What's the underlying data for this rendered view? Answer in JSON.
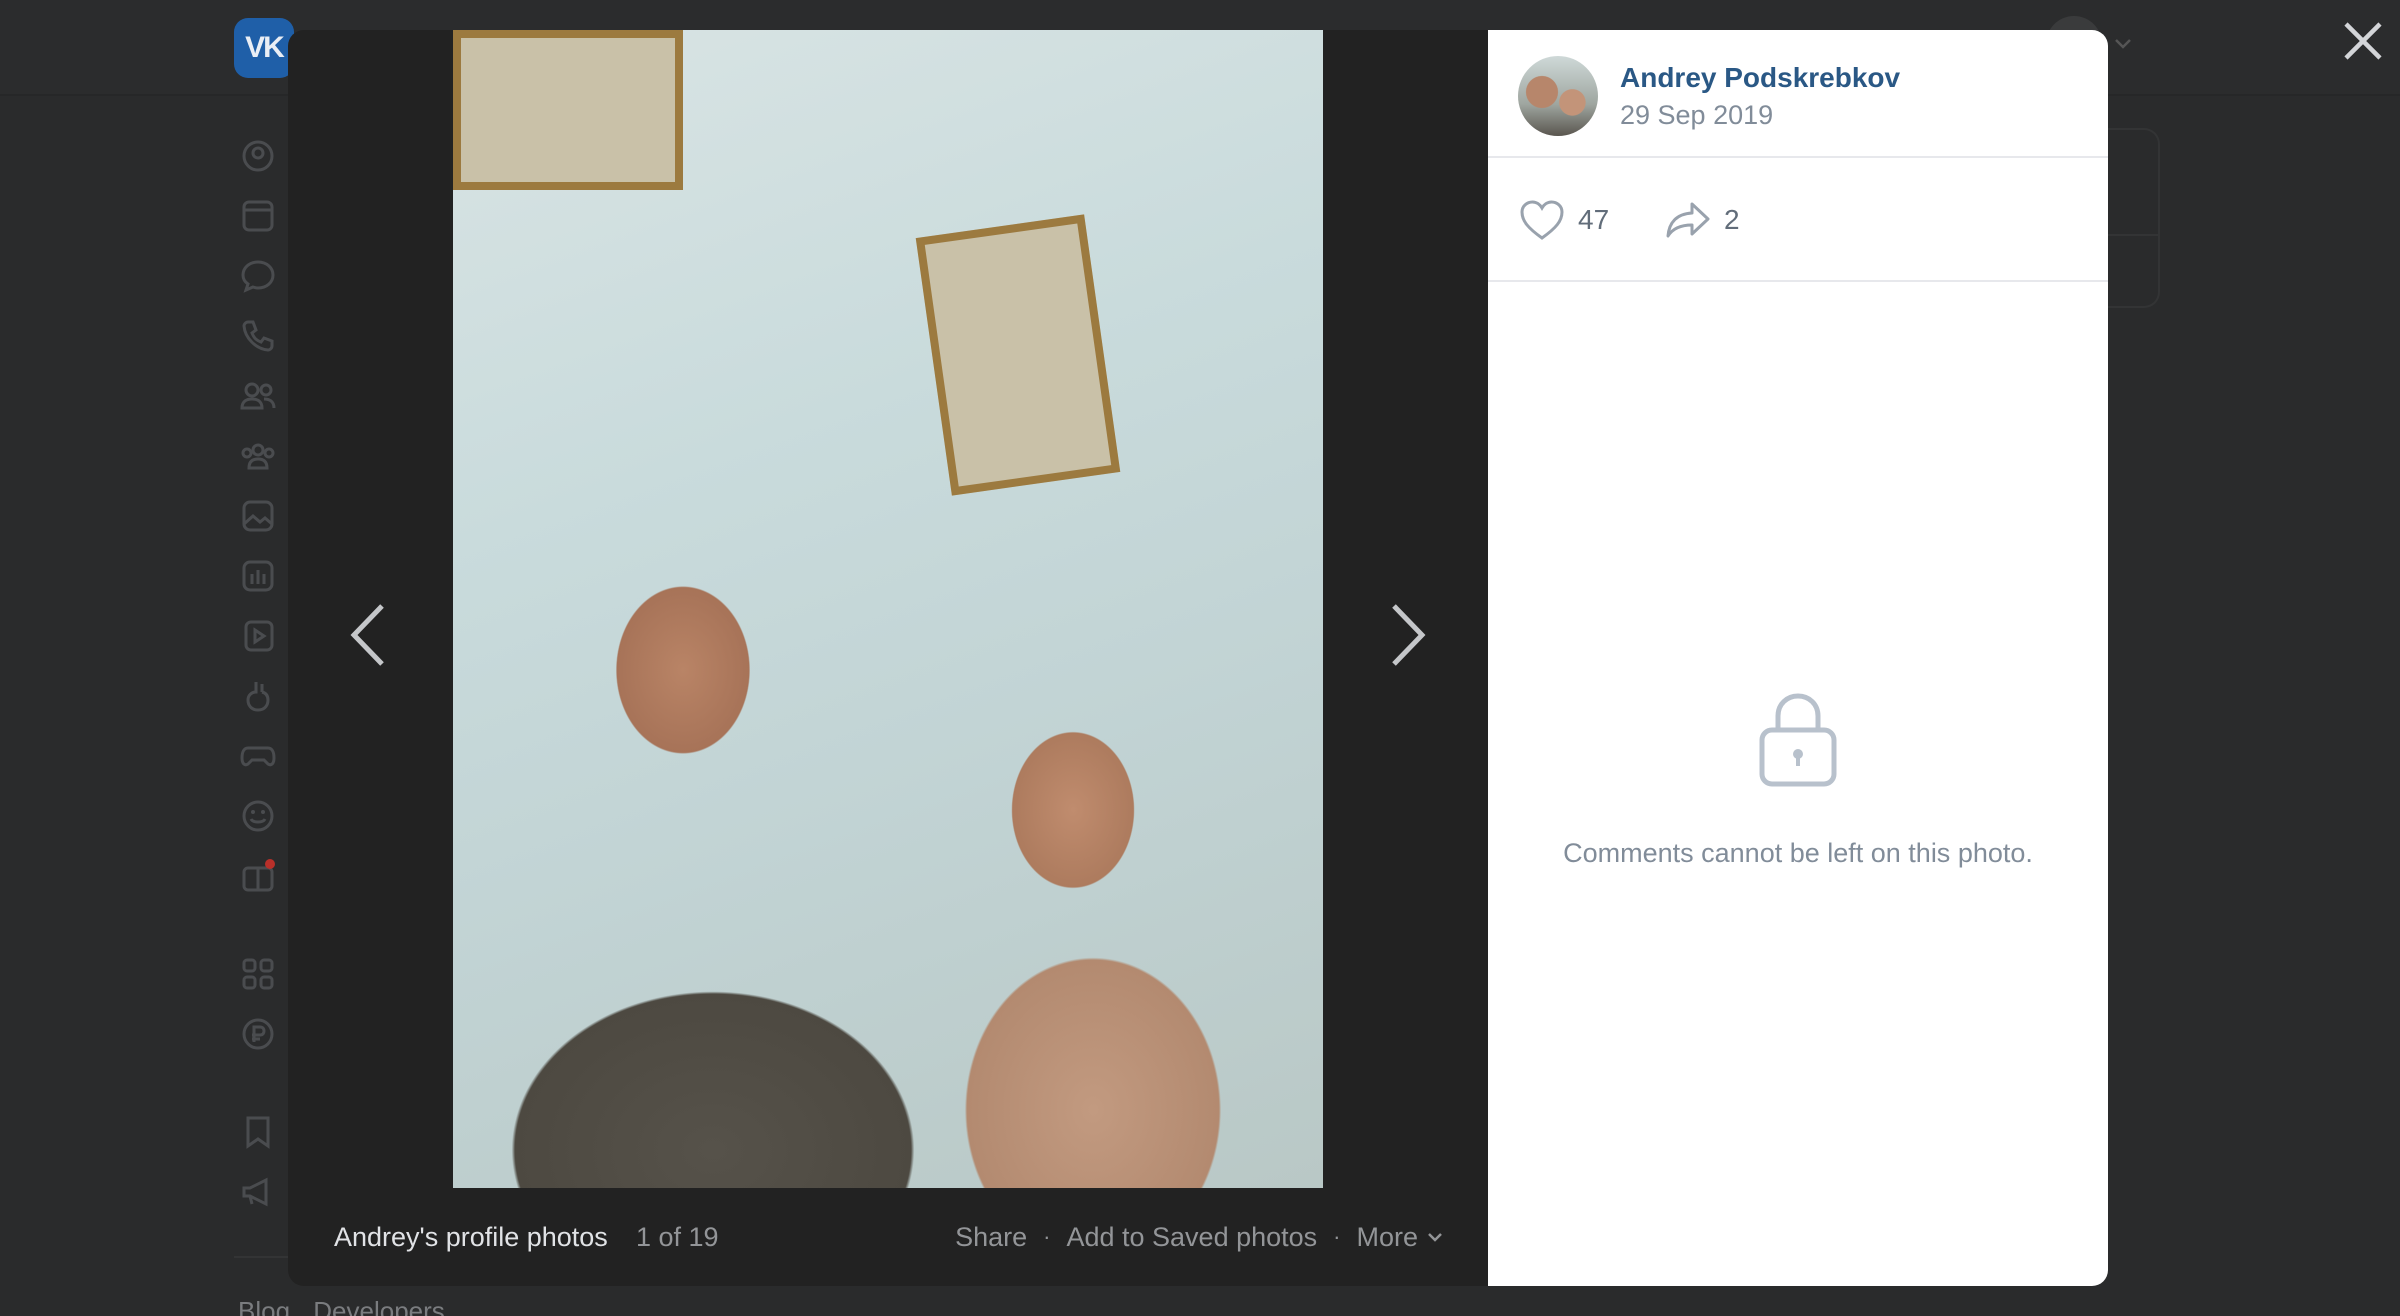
{
  "background_page": {
    "logo_text": "VK",
    "sidebar_icons": [
      "profile-icon",
      "news-icon",
      "messenger-icon",
      "calls-icon",
      "friends-icon",
      "communities-icon",
      "photos-icon",
      "music-icon",
      "video-icon",
      "clips-icon",
      "games-icon",
      "stickers-icon",
      "gifts-icon",
      "mini-apps-icon",
      "vk-pay-icon",
      "bookmarks-icon",
      "advertising-icon"
    ],
    "footer_links": [
      "Blog",
      "Developers"
    ]
  },
  "viewer": {
    "album_title": "Andrey's profile photos",
    "counter": "1 of 19",
    "actions": {
      "share": "Share",
      "save": "Add to Saved photos",
      "more": "More"
    }
  },
  "author": {
    "name": "Andrey Podskrebkov",
    "date": "29 Sep 2019"
  },
  "stats": {
    "likes": "47",
    "shares": "2"
  },
  "comments": {
    "locked_message": "Comments cannot be left on this photo."
  },
  "colors": {
    "link": "#2a5885",
    "secondary_text": "#818c99",
    "viewer_bg": "#222222"
  }
}
